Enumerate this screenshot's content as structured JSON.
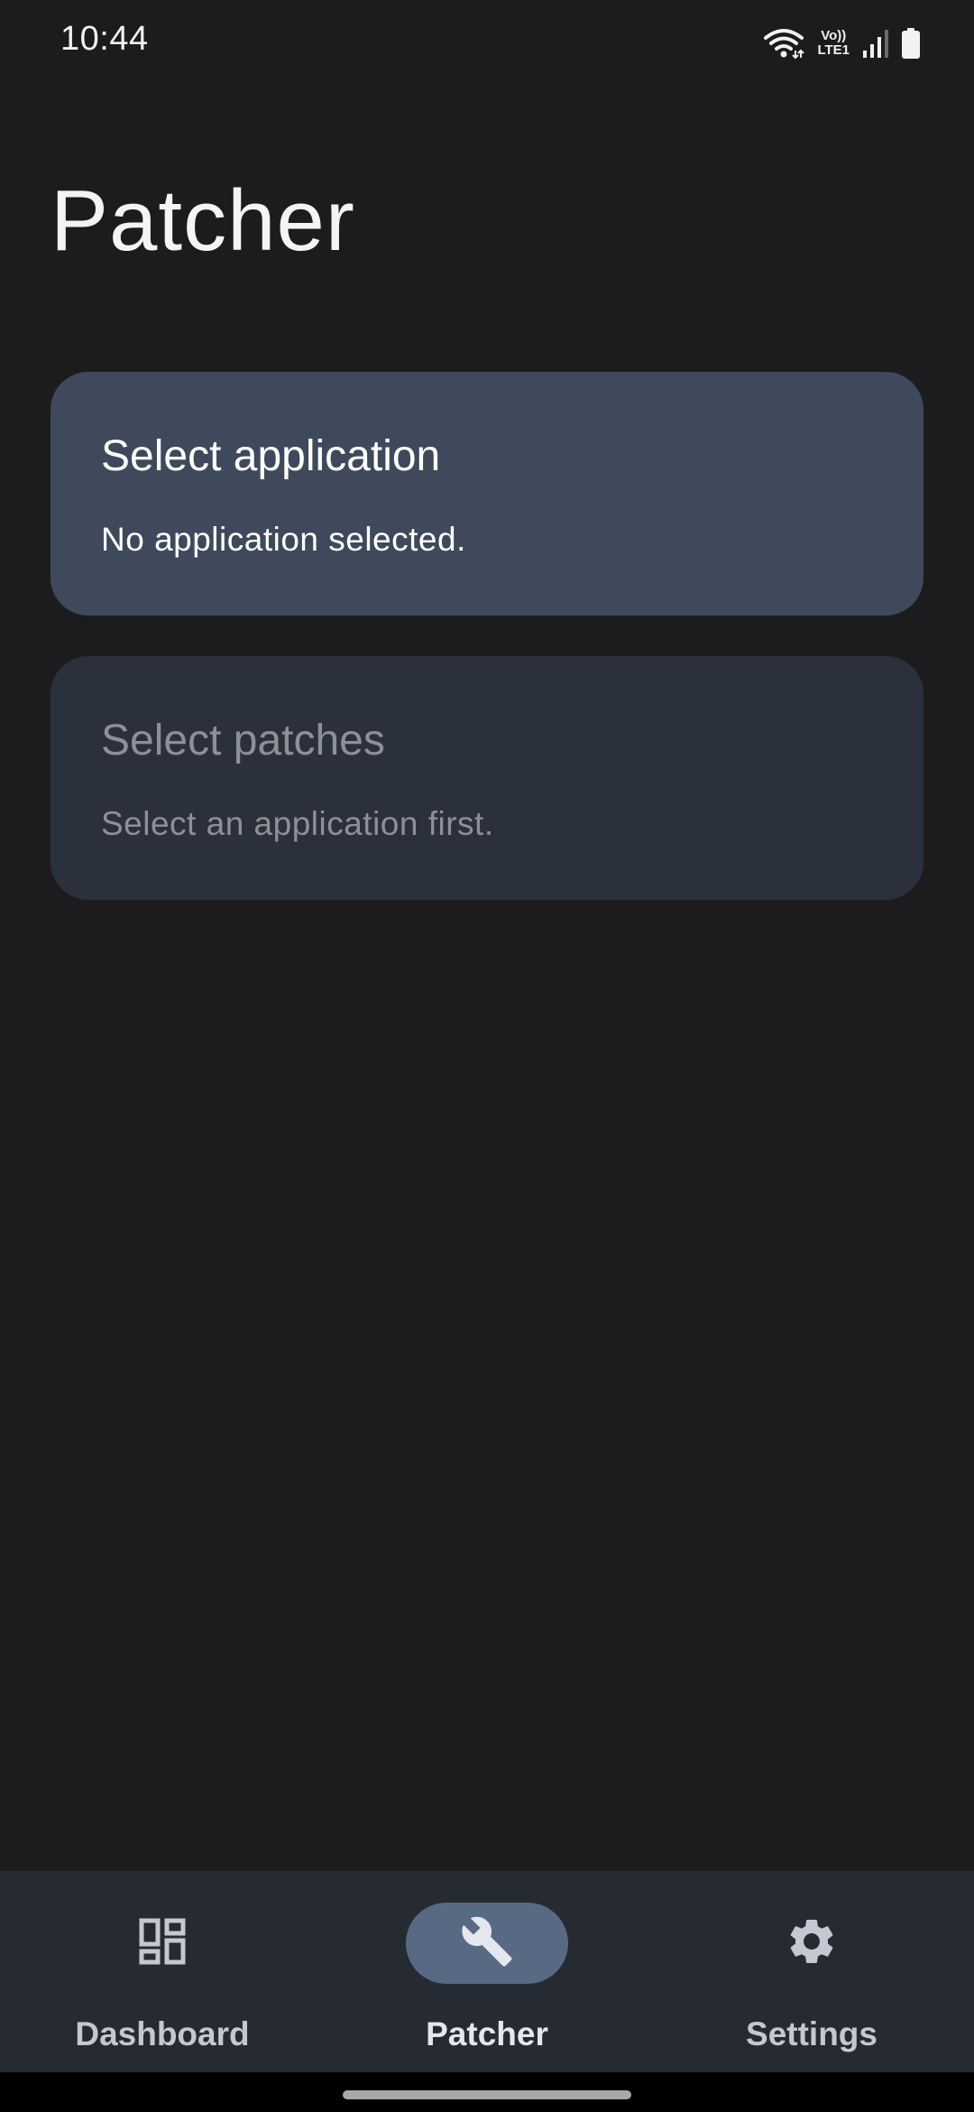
{
  "status_bar": {
    "time": "10:44",
    "volte_top": "Vo))",
    "volte_bottom": "LTE1",
    "icons": [
      "wifi-icon",
      "volte-lte-icon",
      "signal-icon",
      "battery-icon"
    ]
  },
  "page": {
    "title": "Patcher"
  },
  "cards": {
    "select_application": {
      "title": "Select application",
      "subtitle": "No application selected."
    },
    "select_patches": {
      "title": "Select patches",
      "subtitle": "Select an application first."
    }
  },
  "bottom_nav": {
    "items": [
      {
        "label": "Dashboard",
        "icon": "dashboard-icon",
        "active": false
      },
      {
        "label": "Patcher",
        "icon": "wrench-icon",
        "active": true
      },
      {
        "label": "Settings",
        "icon": "gear-icon",
        "active": false
      }
    ]
  },
  "colors": {
    "background": "#1c1c1e",
    "card_active": "#3e4a5b",
    "card_disabled": "#2b313c",
    "nav_background": "#262a33",
    "nav_active_pill": "#586983"
  }
}
